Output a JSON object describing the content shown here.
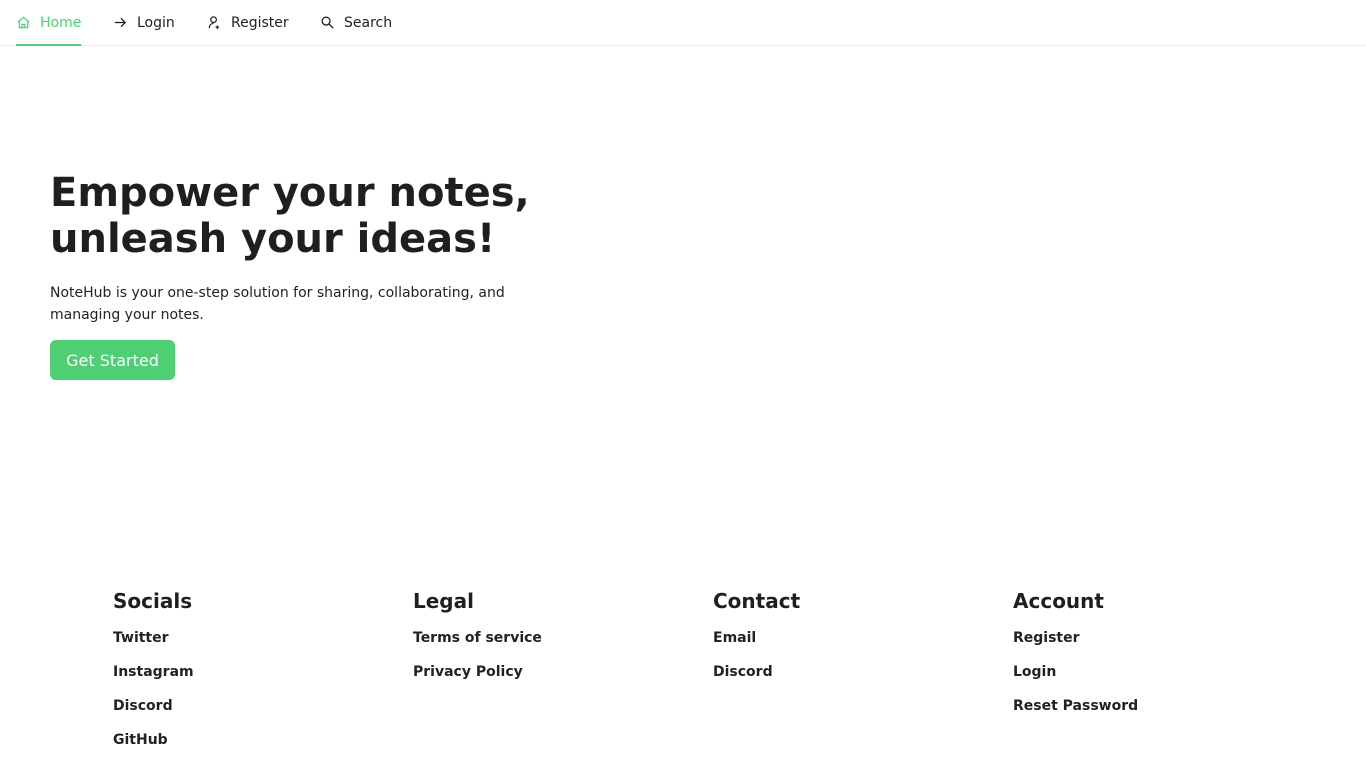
{
  "nav": {
    "items": [
      {
        "label": "Home",
        "icon": "home-icon",
        "active": true
      },
      {
        "label": "Login",
        "icon": "arrow-right-icon",
        "active": false
      },
      {
        "label": "Register",
        "icon": "user-plus-icon",
        "active": false
      },
      {
        "label": "Search",
        "icon": "search-icon",
        "active": false
      }
    ]
  },
  "hero": {
    "title_line1": "Empower your notes,",
    "title_line2": "unleash your ideas!",
    "description": "NoteHub is your one-step solution for sharing, collaborating, and managing your notes.",
    "cta_label": "Get Started"
  },
  "footer": {
    "columns": [
      {
        "title": "Socials",
        "links": [
          "Twitter",
          "Instagram",
          "Discord",
          "GitHub"
        ]
      },
      {
        "title": "Legal",
        "links": [
          "Terms of service",
          "Privacy Policy"
        ]
      },
      {
        "title": "Contact",
        "links": [
          "Email",
          "Discord"
        ]
      },
      {
        "title": "Account",
        "links": [
          "Register",
          "Login",
          "Reset Password"
        ]
      }
    ]
  },
  "colors": {
    "accent": "#4ecf7a",
    "button": "#4ecf74",
    "text": "#1f1f1f"
  }
}
